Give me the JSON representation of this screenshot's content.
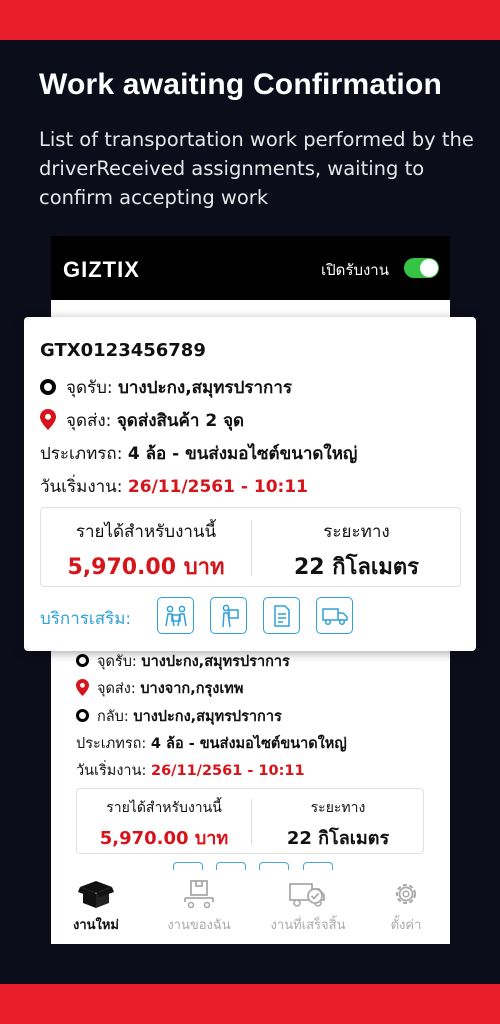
{
  "headline": "Work awaiting Confirmation",
  "subtext": "List of transportation work performed by the driverReceived assignments, waiting to confirm accepting work",
  "app": {
    "logo": "GIZTIX",
    "toggle_label": "เปิดรับงาน",
    "toggle_on": true
  },
  "popup": {
    "job_id": "GTX0123456789",
    "pickup_label": "จุดรับ:",
    "pickup_value": "บางปะกง,สมุทรปราการ",
    "dropoff_label": "จุดส่ง:",
    "dropoff_value": "จุดส่งสินค้า 2 จุด",
    "truck_label": "ประเภทรถ:",
    "truck_value": "4 ล้อ - ขนส่งมอไซต์ขนาดใหญ่",
    "start_label": "วันเริ่มงาน:",
    "start_value": "26/11/2561 - 10:11",
    "income_label": "รายได้สำหรับงานนี้",
    "income_value": "5,970.00 บาท",
    "distance_label": "ระยะทาง",
    "distance_value": "22 กิโลเมตร",
    "services_label": "บริการเสริม:",
    "services": [
      "workers-icon",
      "porter-icon",
      "document-icon",
      "truck-icon"
    ]
  },
  "card": {
    "pickup_label": "จุดรับ:",
    "pickup_value": "บางปะกง,สมุทรปราการ",
    "dropoff_label": "จุดส่ง:",
    "dropoff_value": "บางจาก,กรุงเทพ",
    "return_label": "กลับ:",
    "return_value": "บางปะกง,สมุทรปราการ",
    "truck_label": "ประเภทรถ:",
    "truck_value": "4 ล้อ - ขนส่งมอไซต์ขนาดใหญ่",
    "start_label": "วันเริ่มงาน:",
    "start_value": "26/11/2561 - 10:11",
    "income_label": "รายได้สำหรับงานนี้",
    "income_value": "5,970.00 บาท",
    "distance_label": "ระยะทาง",
    "distance_value": "22 กิโลเมตร"
  },
  "tabs": [
    {
      "label": "งานใหม่",
      "icon": "box-icon",
      "active": true
    },
    {
      "label": "งานของฉัน",
      "icon": "package-cart-icon",
      "active": false
    },
    {
      "label": "งานที่เสร็จสิ้น",
      "icon": "truck-check-icon",
      "active": false
    },
    {
      "label": "ตั้งค่า",
      "icon": "gear-icon",
      "active": false
    }
  ],
  "colors": {
    "brand_red": "#e81f2a",
    "accent_blue": "#2fa1d8",
    "toggle_green": "#35c446",
    "price_red": "#d5141b"
  }
}
